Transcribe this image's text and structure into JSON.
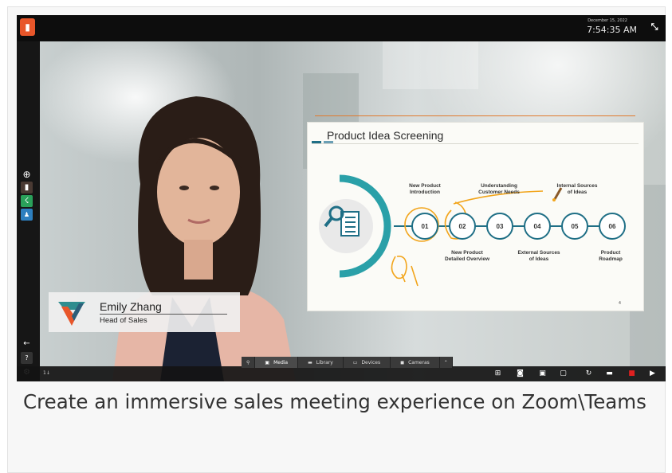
{
  "topbar": {
    "app_logo_icon": "app-logo-icon",
    "date": "December 15, 2022",
    "time": "7:54:35 AM",
    "collapse_icon": "collapse-icon"
  },
  "sidebar": {
    "icons": [
      "globe-icon",
      "timer-icon",
      "presenter-icon",
      "people-icon",
      "back-arrow-icon",
      "help-icon",
      "settings-icon"
    ]
  },
  "slide": {
    "title": "Product Idea Screening",
    "steps": [
      "01",
      "02",
      "03",
      "04",
      "05",
      "06"
    ],
    "top_labels": [
      {
        "line1": "New Product",
        "line2": "Introduction"
      },
      {
        "line1": "Understanding",
        "line2": "Customer Needs"
      },
      {
        "line1": "Internal Sources",
        "line2": "of Ideas"
      }
    ],
    "bottom_labels": [
      {
        "line1": "New Product",
        "line2": "Detailed Overview"
      },
      {
        "line1": "External Sources",
        "line2": "of Ideas"
      },
      {
        "line1": "Product",
        "line2": "Roadmap"
      }
    ],
    "annotation": "Q1",
    "page_number": "4",
    "accent_color": "#1f6f86",
    "ink_color": "#f2a51c"
  },
  "lower_third": {
    "name": "Emily Zhang",
    "role": "Head of Sales"
  },
  "toolbar": {
    "tabs": [
      {
        "label": "Media",
        "icon": "image-icon"
      },
      {
        "label": "Library",
        "icon": "folder-icon"
      },
      {
        "label": "Devices",
        "icon": "monitor-icon"
      },
      {
        "label": "Cameras",
        "icon": "camera-icon"
      }
    ],
    "expand_icon": "chevron-up-icon",
    "left_label": "1↓",
    "right_icons": [
      "layout-grid-icon",
      "snapshot-icon",
      "window-icon",
      "screen-icon",
      "refresh-icon",
      "folder-icon",
      "record-icon",
      "present-icon"
    ]
  },
  "caption": "Create an immersive sales meeting experience on Zoom\\Teams"
}
